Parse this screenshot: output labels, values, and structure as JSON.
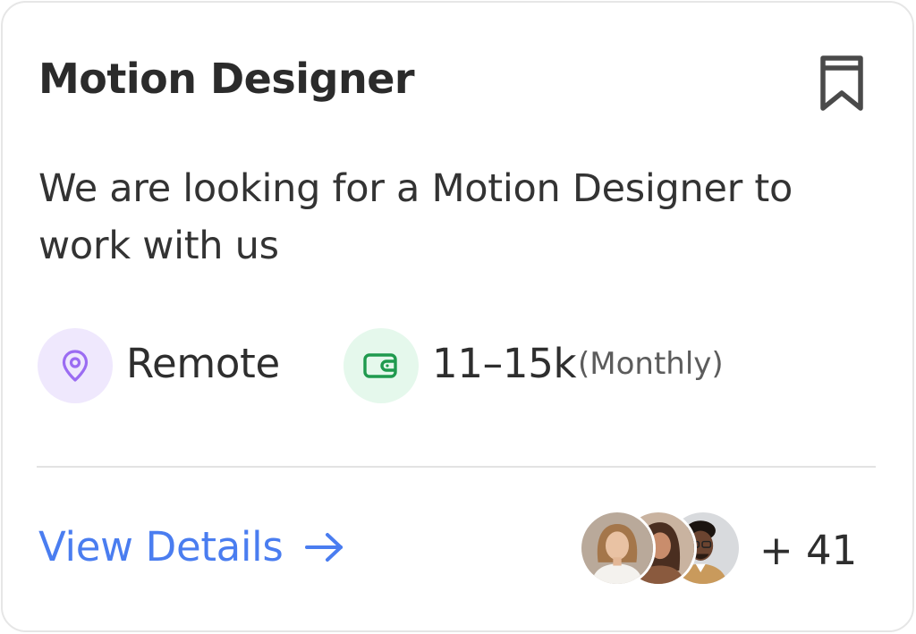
{
  "job": {
    "title": "Motion Designer",
    "description": "We are looking for a Motion Designer to work with us",
    "location": "Remote",
    "salary": "11–15k",
    "salary_period": "(Monthly)"
  },
  "actions": {
    "view_details_label": "View Details"
  },
  "applicants": {
    "extra_count_label": "+ 41"
  },
  "icons": {
    "bookmark": "bookmark-icon",
    "location": "map-pin-icon",
    "salary": "wallet-icon",
    "arrow": "arrow-right-icon"
  },
  "colors": {
    "title": "#2b2b2b",
    "link": "#4a7df0",
    "location_icon": "#9b6cf2",
    "location_bg": "#efe8fd",
    "salary_icon": "#1f9a4e",
    "salary_bg": "#e5f8ec"
  }
}
